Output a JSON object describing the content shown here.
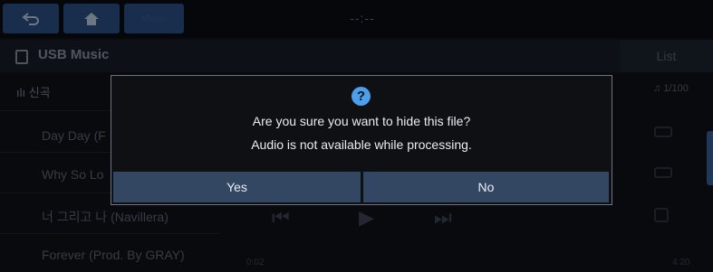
{
  "topbar": {
    "clock": "--:--",
    "menu_label": "Menu"
  },
  "header": {
    "title": "USB Music",
    "list_label": "List"
  },
  "list": {
    "category": "신곡",
    "songs": [
      "Day Day (F",
      "Why So Lo",
      "너 그리고 나 (Navillera)",
      "Forever (Prod. By GRAY)"
    ]
  },
  "player": {
    "track_count": "1/100",
    "time_elapsed": "0:02",
    "time_total": "4:20"
  },
  "dialog": {
    "icon": "question-icon",
    "line1": "Are you sure you want to hide this file?",
    "line2": "Audio is not available while processing.",
    "yes_label": "Yes",
    "no_label": "No",
    "icon_color": "#4aa0ea",
    "button_color": "#334763"
  }
}
